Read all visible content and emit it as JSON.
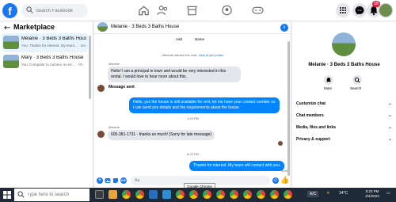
{
  "top": {
    "logo": "f",
    "search_placeholder": "Search Facebook",
    "notif_count": "10"
  },
  "sidebar": {
    "back_arrow": "←",
    "title": "Marketplace",
    "conversations": [
      {
        "title": "Melanie · 3 Beds 3 Baths House",
        "preview": "You: Thanks for interest. My team... · 1m"
      },
      {
        "title": "Mary · 3 Beds 3 Baths House",
        "preview": "You: Compartir tu número no es... · 7m"
      }
    ]
  },
  "chat": {
    "title": "Melanie · 3 Beds 3 Baths House",
    "info_icon": "i",
    "top_actions": [
      "Add",
      "Name"
    ],
    "system_message": "Melanie started this chat.",
    "system_link": "View buyer profile",
    "messages": [
      {
        "sender": "Melanie",
        "text": "Hello! I am a principal in town and would be very interested in this rental. I would love to hear more about this."
      },
      {
        "status": "Message sent"
      },
      {
        "text": "Hello, yes the house is still available for rent, let me have your contact number so i can send you details and the requirements about the house"
      },
      {
        "timestamp": "1:29 PM"
      },
      {
        "sender": "Melanie",
        "text": "605-381-1731 - thanks so much! (Sorry for late message)"
      },
      {
        "timestamp": "8:23 PM"
      },
      {
        "text": "Thanks for interest. My team will contact with you."
      }
    ],
    "sent_label": "Sent",
    "composer_placeholder": "Aa",
    "like_icon": "👍"
  },
  "tooltip": "Google Chrome",
  "panel": {
    "name": "Melanie · 3 Beds 3 Baths House",
    "mute_label": "Mute",
    "search_label": "Search",
    "sections": [
      "Customize chat",
      "Chat members",
      "Media, files and links",
      "Privacy & support"
    ],
    "chevron": "⌄"
  },
  "taskbar": {
    "search_placeholder": "Type here to search",
    "lang": "A/C",
    "weather": "14°C",
    "time": "8:23 PM",
    "date": "2/4/2023"
  },
  "colors": {
    "brand": "#1877f2",
    "outgoing_bubble": "#0084ff",
    "incoming_bubble": "#e4e6eb"
  }
}
